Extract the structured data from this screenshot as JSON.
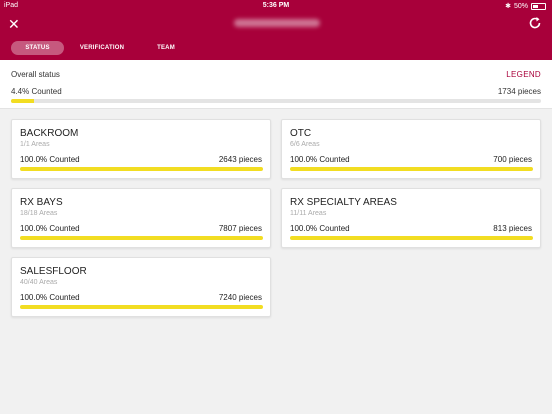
{
  "status_bar": {
    "device": "iPad",
    "time": "5:36 PM",
    "battery": "50%",
    "bluetooth_icon": "bluetooth-icon"
  },
  "header": {
    "close_icon": "close-icon",
    "refresh_icon": "refresh-icon"
  },
  "tabs": [
    {
      "label": "STATUS",
      "active": true
    },
    {
      "label": "VERIFICATION",
      "active": false
    },
    {
      "label": "TEAM",
      "active": false
    }
  ],
  "overall": {
    "label": "Overall status",
    "legend": "LEGEND",
    "counted_text": "4.4% Counted",
    "progress": 0.044,
    "pieces": "1734 pieces"
  },
  "areas": [
    {
      "name": "BACKROOM",
      "areas": "1/1 Areas",
      "counted": "100.0% Counted",
      "pieces": "2643 pieces",
      "progress": 1.0
    },
    {
      "name": "OTC",
      "areas": "6/6 Areas",
      "counted": "100.0% Counted",
      "pieces": "700 pieces",
      "progress": 1.0
    },
    {
      "name": "RX BAYS",
      "areas": "18/18 Areas",
      "counted": "100.0% Counted",
      "pieces": "7807 pieces",
      "progress": 1.0
    },
    {
      "name": "RX SPECIALTY AREAS",
      "areas": "11/11 Areas",
      "counted": "100.0% Counted",
      "pieces": "813 pieces",
      "progress": 1.0
    },
    {
      "name": "SALESFLOOR",
      "areas": "40/40 Areas",
      "counted": "100.0% Counted",
      "pieces": "7240 pieces",
      "progress": 1.0
    }
  ],
  "colors": {
    "brand": "#a8003a",
    "progress": "#f2dd22",
    "track": "#e4e4e4"
  }
}
